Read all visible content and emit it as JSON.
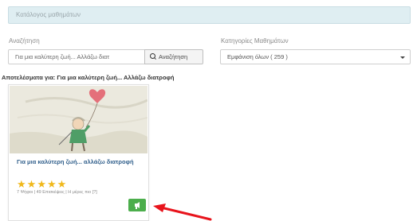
{
  "catalog_header": {
    "title": "Κατάλογος μαθημάτων"
  },
  "search": {
    "label": "Αναζήτηση",
    "value": "Για μια καλύτερη ζωή... Αλλάζω διατ",
    "button_label": "Αναζήτηση",
    "icon": "search-icon"
  },
  "categories": {
    "label": "Κατηγορίες Μαθημάτων",
    "selected": "Εμφάνιση όλων ( 259 )"
  },
  "results": {
    "text": "Αποτελέσματα για: Για μια καλύτερη ζωή... Αλλάζω διατροφή"
  },
  "course_card": {
    "title": "Για μια καλύτερη ζωή... αλλάζω διατροφή",
    "rating": 5,
    "rating_max": 5,
    "meta": "7 Ψήφοι | 49 Επισκέψεις | Η μέρες πιο [?]",
    "enroll_icon": "enroll-icon",
    "accent_color": "#4cae4c",
    "title_color": "#2e5d8a",
    "star_color": "#f0b81a"
  },
  "annotation": {
    "arrow_color": "#e8141c",
    "icon": "red-arrow-icon"
  }
}
